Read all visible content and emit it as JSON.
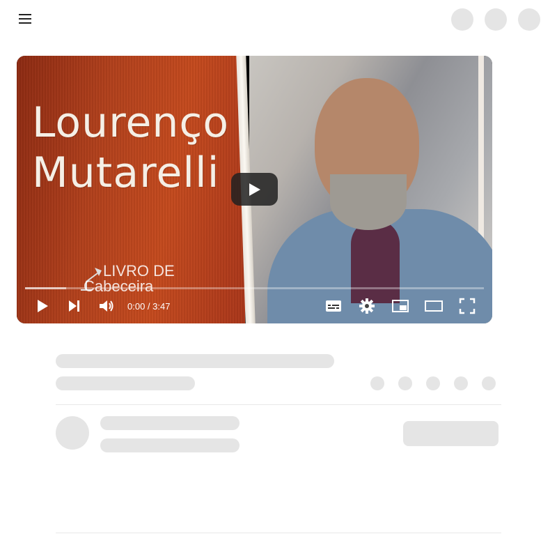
{
  "header": {
    "menu_icon": "hamburger-menu-icon",
    "right_placeholders": 3
  },
  "video": {
    "thumbnail_title": "Lourenço\nMutarelli",
    "watermark_line1": "LIVRO DE",
    "watermark_line2": "Cabeceira",
    "time_display": "0:00 / 3:47",
    "current_time": "0:00",
    "duration": "3:47",
    "buffered_fraction": 0.09,
    "controls": {
      "play_icon": "play-icon",
      "next_icon": "next-icon",
      "volume_icon": "volume-icon",
      "subtitles_icon": "subtitles-icon",
      "settings_icon": "settings-icon",
      "miniplayer_icon": "miniplayer-icon",
      "theater_icon": "theater-mode-icon",
      "fullscreen_icon": "fullscreen-icon"
    }
  },
  "colors": {
    "thumbnail_red": "#b1401c",
    "control_icons": "#ffffff",
    "skeleton": "#e5e5e5"
  }
}
